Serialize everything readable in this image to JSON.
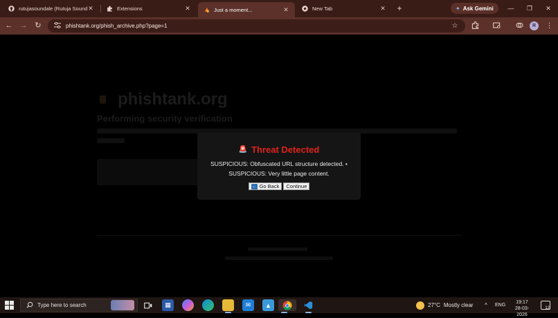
{
  "browser": {
    "tabs": [
      {
        "label": "rutujasoundale (Rutuja Soundale)",
        "icon": "github-icon",
        "active": false
      },
      {
        "label": "Extensions",
        "icon": "puzzle-icon",
        "active": false
      },
      {
        "label": "Just a moment...",
        "icon": "cloudflare-icon",
        "active": true
      },
      {
        "label": "New Tab",
        "icon": "chrome-icon",
        "active": false
      }
    ],
    "new_tab_symbol": "+",
    "gemini_label": "Ask Gemini",
    "window_controls": {
      "minimize": "—",
      "restore": "❐",
      "close": "✕"
    },
    "tab_close_symbol": "✕",
    "nav": {
      "back": "←",
      "forward": "→",
      "reload": "↻"
    },
    "url": "phishtank.org/phish_archive.php?page=1",
    "profile_initial": "R",
    "accent": "#5b3129"
  },
  "page": {
    "background_logo": "phishtank.org",
    "background_heading": "Performing security verification"
  },
  "dialog": {
    "title": "Threat Detected",
    "title_icon": "🚨",
    "message_line_1": "SUSPICIOUS: Obfuscated URL structure detected. •",
    "message_line_2": "SUSPICIOUS: Very little page content.",
    "go_back_label": "Go Back",
    "continue_label": "Continue",
    "title_color": "#e0231b"
  },
  "taskbar": {
    "search_placeholder": "Type here to search",
    "weather_temp": "27°C",
    "weather_text": "Mostly clear",
    "language": "ENG",
    "time": "19:17",
    "date": "28-03-2026",
    "notification_count": "12"
  }
}
